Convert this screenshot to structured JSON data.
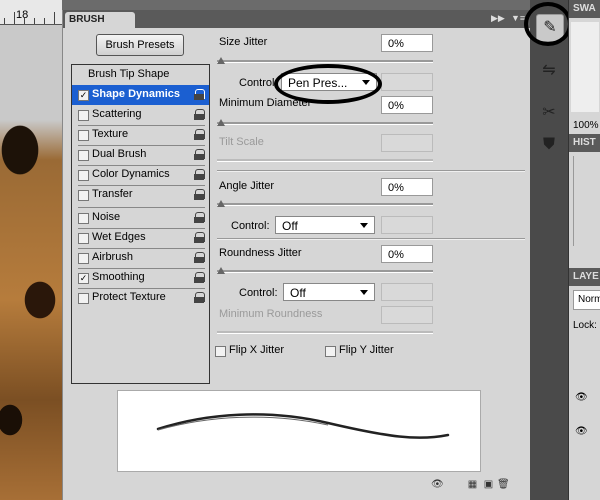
{
  "ruler": {
    "value": "18"
  },
  "panel": {
    "tab": "BRUSH",
    "presets_button": "Brush Presets"
  },
  "left_list": [
    {
      "label": "Brush Tip Shape",
      "checkbox": false,
      "checked": false,
      "lock": false,
      "selected": false
    },
    {
      "label": "Shape Dynamics",
      "checkbox": true,
      "checked": true,
      "lock": true,
      "selected": true
    },
    {
      "label": "Scattering",
      "checkbox": true,
      "checked": false,
      "lock": true,
      "selected": false
    },
    {
      "label": "Texture",
      "checkbox": true,
      "checked": false,
      "lock": true,
      "selected": false
    },
    {
      "label": "Dual Brush",
      "checkbox": true,
      "checked": false,
      "lock": true,
      "selected": false
    },
    {
      "label": "Color Dynamics",
      "checkbox": true,
      "checked": false,
      "lock": true,
      "selected": false
    },
    {
      "label": "Transfer",
      "checkbox": true,
      "checked": false,
      "lock": true,
      "selected": false
    },
    {
      "label": "Noise",
      "checkbox": true,
      "checked": false,
      "lock": true,
      "selected": false
    },
    {
      "label": "Wet Edges",
      "checkbox": true,
      "checked": false,
      "lock": true,
      "selected": false
    },
    {
      "label": "Airbrush",
      "checkbox": true,
      "checked": false,
      "lock": true,
      "selected": false
    },
    {
      "label": "Smoothing",
      "checkbox": true,
      "checked": true,
      "lock": true,
      "selected": false
    },
    {
      "label": "Protect Texture",
      "checkbox": true,
      "checked": false,
      "lock": true,
      "selected": false
    }
  ],
  "check_mark": "✓",
  "controls": {
    "size_jitter": {
      "label": "Size Jitter",
      "value": "0%"
    },
    "size_control": {
      "label": "Control:",
      "value": "Pen Pres..."
    },
    "min_diameter": {
      "label": "Minimum Diameter",
      "value": "0%"
    },
    "tilt_scale": {
      "label": "Tilt Scale"
    },
    "angle_jitter": {
      "label": "Angle Jitter",
      "value": "0%"
    },
    "angle_control": {
      "label": "Control:",
      "value": "Off"
    },
    "roundness_jitter": {
      "label": "Roundness Jitter",
      "value": "0%"
    },
    "roundness_control": {
      "label": "Control:",
      "value": "Off"
    },
    "min_roundness": {
      "label": "Minimum Roundness"
    },
    "flip_x": {
      "label": "Flip X Jitter"
    },
    "flip_y": {
      "label": "Flip Y Jitter"
    }
  },
  "far_right": {
    "swatches_tab": "SWA",
    "zoom": "100%",
    "history_tab": "HIST",
    "layers_tab": "LAYE",
    "blend_mode": "Norm",
    "lock_label": "Lock:"
  },
  "colors": {
    "selected": "#1b5fd1",
    "panel": "#d6d6d6",
    "header": "#5a5a5a"
  }
}
